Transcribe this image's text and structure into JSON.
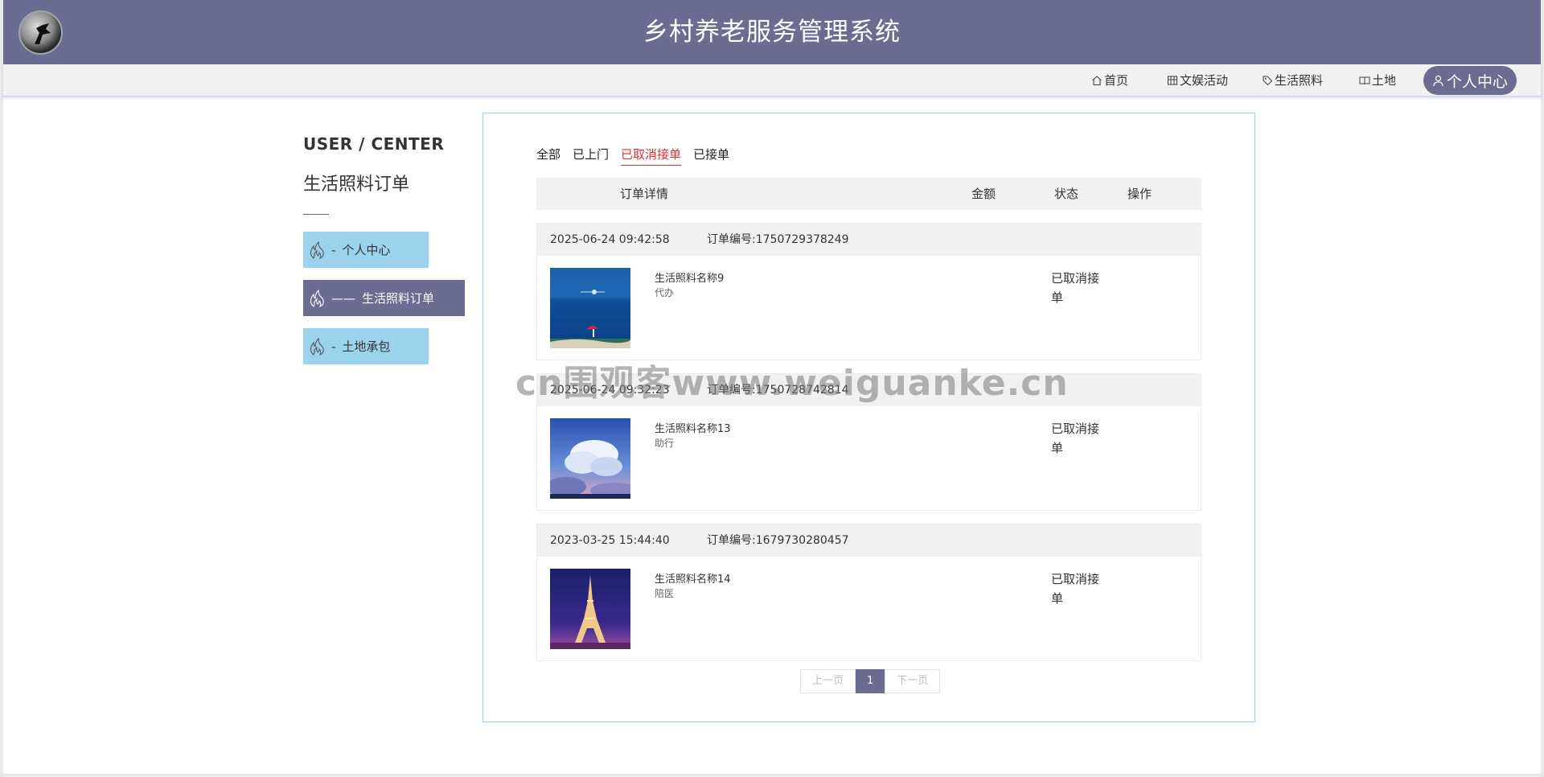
{
  "header": {
    "title": "乡村养老服务管理系统",
    "logo": "bird-logo"
  },
  "nav": {
    "items": [
      {
        "label": "首页",
        "icon": "home-icon"
      },
      {
        "label": "文娱活动",
        "icon": "grid-icon"
      },
      {
        "label": "生活照料",
        "icon": "tag-icon"
      },
      {
        "label": "土地",
        "icon": "book-icon"
      }
    ],
    "active": {
      "label": "个人中心",
      "icon": "user-icon"
    }
  },
  "sidebar": {
    "title": "USER / CENTER",
    "subtitle": "生活照料订单",
    "items": [
      {
        "label": "个人中心",
        "dash": "-",
        "active": false
      },
      {
        "label": "生活照料订单",
        "dash": "——",
        "active": true
      },
      {
        "label": "土地承包",
        "dash": "-",
        "active": false
      }
    ]
  },
  "tabs": [
    {
      "label": "全部",
      "active": false
    },
    {
      "label": "已上门",
      "active": false
    },
    {
      "label": "已取消接单",
      "active": true
    },
    {
      "label": "已接单",
      "active": false
    }
  ],
  "table": {
    "headers": {
      "detail": "订单详情",
      "amount": "金额",
      "status": "状态",
      "action": "操作"
    }
  },
  "orders": [
    {
      "time": "2025-06-24 09:42:58",
      "order_no": "订单编号:1750729378249",
      "name": "生活照料名称9",
      "type": "代办",
      "status_line1": "已取消接",
      "status_line2": "单",
      "image": "ocean-umbrella-image"
    },
    {
      "time": "2025-06-24 09:32:23",
      "order_no": "订单编号:1750728742814",
      "name": "生活照料名称13",
      "type": "助行",
      "status_line1": "已取消接",
      "status_line2": "单",
      "image": "clouds-sky-image"
    },
    {
      "time": "2023-03-25 15:44:40",
      "order_no": "订单编号:1679730280457",
      "name": "生活照料名称14",
      "type": "陪医",
      "status_line1": "已取消接",
      "status_line2": "单",
      "image": "eiffel-tower-image"
    }
  ],
  "pager": {
    "prev": "上一页",
    "current": "1",
    "next": "下一页"
  },
  "watermark": "cn围观客www.weiguanke.cn",
  "colors": {
    "primary": "#6c6b91",
    "sidebar": "#9ad3eb",
    "active_tab": "#e03030"
  }
}
